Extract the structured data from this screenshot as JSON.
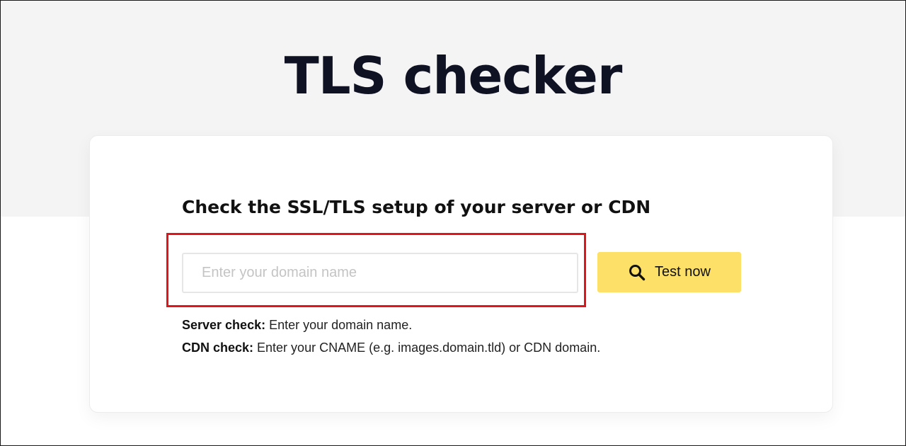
{
  "page": {
    "title": "TLS checker"
  },
  "card": {
    "heading": "Check the SSL/TLS setup of your server or CDN"
  },
  "search": {
    "placeholder": "Enter your domain name",
    "value": ""
  },
  "button": {
    "label": "Test now",
    "icon": "search-icon",
    "color": "#fde068"
  },
  "hints": {
    "server_label": "Server check:",
    "server_text": " Enter your domain name.",
    "cdn_label": "CDN check:",
    "cdn_text": " Enter your CNAME (e.g. images.domain.tld) or CDN domain."
  },
  "colors": {
    "highlight": "#e0141b",
    "title": "#0f1222",
    "hero_background": "#f4f4f4"
  }
}
